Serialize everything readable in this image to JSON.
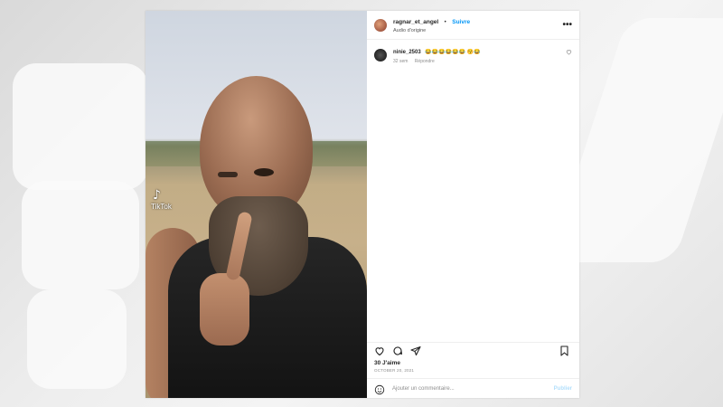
{
  "post": {
    "username": "ragnar_et_angel",
    "separator": "•",
    "follow_label": "Suivre",
    "audio_label": "Audio d'origine",
    "more_label": "•••",
    "media": {
      "tiktok_logo": "♪",
      "tiktok_label": "TikTok"
    },
    "comments": [
      {
        "username": "ninie_2503",
        "text": "😂😂😂😂😂😂 😚😂",
        "time": "32 sem",
        "reply_label": "Répondre",
        "like_icon": "heart-outline-icon"
      }
    ],
    "actions": {
      "like_icon": "heart-outline-icon",
      "comment_icon": "comment-bubble-icon",
      "share_icon": "paper-plane-icon",
      "save_icon": "bookmark-icon"
    },
    "likes_text": "30 J'aime",
    "date_text": "OCTOBER 20, 2021",
    "add_comment_placeholder": "Ajouter un commentaire...",
    "publish_label": "Publier"
  },
  "colors": {
    "link_blue": "#0095f6",
    "publish_disabled": "#b2dffc",
    "muted_text": "#8e8e8e"
  }
}
